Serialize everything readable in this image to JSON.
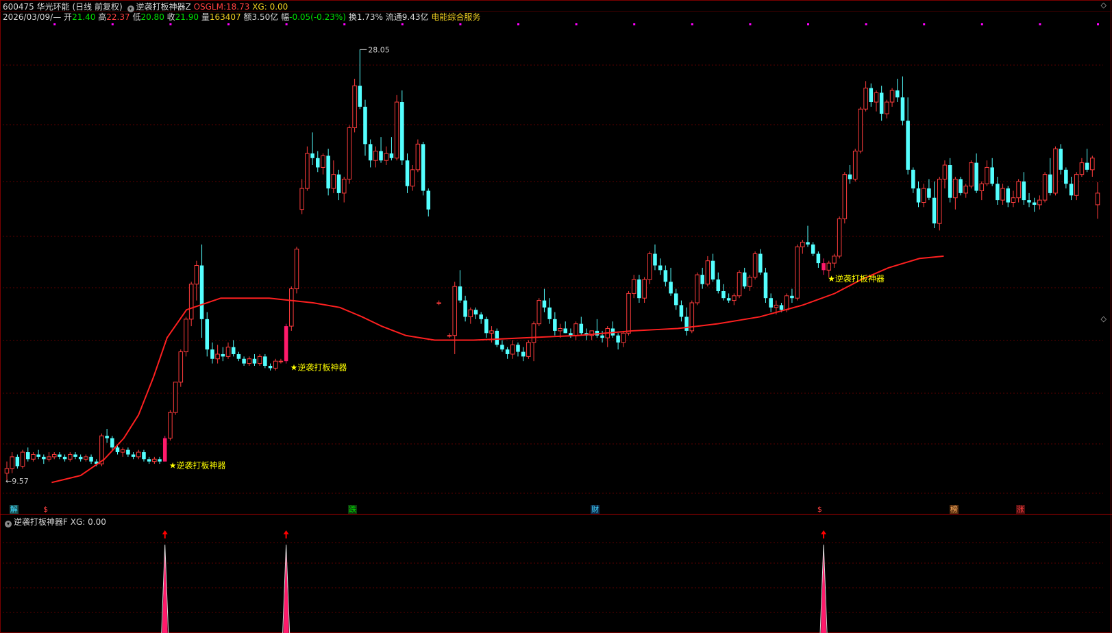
{
  "header": {
    "code": "600475",
    "name": "华光环能",
    "period": "(日线 前复权)",
    "indicator_name": "逆袭打板神器Z",
    "osglm_label": "OSGLM:",
    "osglm_value": "18.73",
    "xg_label": "XG:",
    "xg_value": "0.00",
    "date": "2026/03/09/—",
    "open_label": "开",
    "open": "21.40",
    "high_label": "高",
    "high": "22.37",
    "low_label": "低",
    "low": "20.80",
    "close_label": "收",
    "close": "21.90",
    "volume_label": "量",
    "volume": "163407",
    "amount_label": "额",
    "amount": "3.50亿",
    "change_label": "幅",
    "change": "-0.05(-0.23%)",
    "turnover_label": "换",
    "turnover": "1.73%",
    "float_label": "流通",
    "float_cap": "9.43亿",
    "sector": "电能综合服务"
  },
  "sub_panel": {
    "title": "逆袭打板神器F",
    "xg_label": "XG:",
    "xg_value": "0.00"
  },
  "window_buttons": {
    "top": "◇",
    "bottom": "◇"
  },
  "colors": {
    "background": "#000000",
    "up": "#ff3c3c",
    "down": "#54ffff",
    "ma": "#ff2020",
    "signal": "#ff1a6b",
    "label": "#ffff00",
    "grid": "#7a0000",
    "marker": "#ff00ff"
  },
  "chart_data": {
    "type": "candlestick",
    "price_range": [
      9.57,
      28.05
    ],
    "ylim": [
      8.6,
      29.0
    ],
    "max_label": "28.05",
    "min_label": "9.57",
    "signal_label": "★逆袭打板神器",
    "signals_at": [
      30,
      53,
      155
    ],
    "candles": [
      [
        9.9,
        10.4,
        9.6,
        10.1
      ],
      [
        10.1,
        10.8,
        9.9,
        10.6
      ],
      [
        10.6,
        10.7,
        10.1,
        10.2
      ],
      [
        10.2,
        10.9,
        10.1,
        10.8
      ],
      [
        10.8,
        11.0,
        10.4,
        10.5
      ],
      [
        10.5,
        10.8,
        10.4,
        10.7
      ],
      [
        10.7,
        10.9,
        10.5,
        10.6
      ],
      [
        10.6,
        10.7,
        10.3,
        10.5
      ],
      [
        10.5,
        10.8,
        10.4,
        10.6
      ],
      [
        10.6,
        10.8,
        10.5,
        10.7
      ],
      [
        10.7,
        10.8,
        10.5,
        10.6
      ],
      [
        10.6,
        10.7,
        10.4,
        10.5
      ],
      [
        10.5,
        10.8,
        10.4,
        10.7
      ],
      [
        10.7,
        10.8,
        10.5,
        10.6
      ],
      [
        10.6,
        10.7,
        10.4,
        10.5
      ],
      [
        10.5,
        10.7,
        10.4,
        10.6
      ],
      [
        10.6,
        10.7,
        10.3,
        10.4
      ],
      [
        10.4,
        10.5,
        10.2,
        10.3
      ],
      [
        10.3,
        11.6,
        10.2,
        11.5
      ],
      [
        11.5,
        11.8,
        11.2,
        11.4
      ],
      [
        11.4,
        11.5,
        10.9,
        11.0
      ],
      [
        11.0,
        11.1,
        10.7,
        10.8
      ],
      [
        10.8,
        11.0,
        10.6,
        10.9
      ],
      [
        10.9,
        11.0,
        10.6,
        10.7
      ],
      [
        10.7,
        10.8,
        10.5,
        10.6
      ],
      [
        10.6,
        10.9,
        10.5,
        10.8
      ],
      [
        10.8,
        10.9,
        10.4,
        10.5
      ],
      [
        10.5,
        10.6,
        10.3,
        10.4
      ],
      [
        10.4,
        10.6,
        10.3,
        10.5
      ],
      [
        10.5,
        10.6,
        10.3,
        10.4
      ],
      [
        10.4,
        11.5,
        10.4,
        11.4
      ],
      [
        11.4,
        12.6,
        11.3,
        12.5
      ],
      [
        12.5,
        13.8,
        12.4,
        13.8
      ],
      [
        13.8,
        15.2,
        13.6,
        15.1
      ],
      [
        15.1,
        16.6,
        14.9,
        16.5
      ],
      [
        16.5,
        18.1,
        16.2,
        18.0
      ],
      [
        18.0,
        19.0,
        17.3,
        18.8
      ],
      [
        18.8,
        19.7,
        15.7,
        16.5
      ],
      [
        16.5,
        16.8,
        14.9,
        15.2
      ],
      [
        15.2,
        15.5,
        14.6,
        14.8
      ],
      [
        14.8,
        15.4,
        14.6,
        15.0
      ],
      [
        15.0,
        15.3,
        14.7,
        14.9
      ],
      [
        14.9,
        15.5,
        14.8,
        15.3
      ],
      [
        15.3,
        15.6,
        14.9,
        15.0
      ],
      [
        15.0,
        15.1,
        14.7,
        14.8
      ],
      [
        14.8,
        14.9,
        14.5,
        14.6
      ],
      [
        14.6,
        14.9,
        14.5,
        14.8
      ],
      [
        14.8,
        15.0,
        14.5,
        14.6
      ],
      [
        14.6,
        15.0,
        14.5,
        14.9
      ],
      [
        14.9,
        15.0,
        14.4,
        14.5
      ],
      [
        14.5,
        14.6,
        14.3,
        14.4
      ],
      [
        14.4,
        14.8,
        14.3,
        14.7
      ],
      [
        14.7,
        14.8,
        14.6,
        14.7
      ],
      [
        14.7,
        16.3,
        14.6,
        16.2
      ],
      [
        16.2,
        17.9,
        16.0,
        17.8
      ],
      [
        17.8,
        19.6,
        17.6,
        19.5
      ],
      [
        21.2,
        22.5,
        21.0,
        22.1
      ],
      [
        22.1,
        23.9,
        22.0,
        23.6
      ],
      [
        23.6,
        24.5,
        23.1,
        23.4
      ],
      [
        23.4,
        23.7,
        22.8,
        23.0
      ],
      [
        23.0,
        23.6,
        22.7,
        23.5
      ],
      [
        23.5,
        23.8,
        21.8,
        22.1
      ],
      [
        22.1,
        23.3,
        21.9,
        22.7
      ],
      [
        22.7,
        22.9,
        21.6,
        21.9
      ],
      [
        21.9,
        22.6,
        21.5,
        22.5
      ],
      [
        22.5,
        24.8,
        22.3,
        24.7
      ],
      [
        24.7,
        26.8,
        24.5,
        26.5
      ],
      [
        26.5,
        28.05,
        25.5,
        25.6
      ],
      [
        25.6,
        25.9,
        23.5,
        24.0
      ],
      [
        24.0,
        24.2,
        23.0,
        23.3
      ],
      [
        23.3,
        23.9,
        23.0,
        23.7
      ],
      [
        23.7,
        24.3,
        23.2,
        23.3
      ],
      [
        23.3,
        23.9,
        23.1,
        23.6
      ],
      [
        23.6,
        24.3,
        23.3,
        23.4
      ],
      [
        23.4,
        26.1,
        23.3,
        25.8
      ],
      [
        25.8,
        26.3,
        23.1,
        23.3
      ],
      [
        23.3,
        23.6,
        21.9,
        22.2
      ],
      [
        22.2,
        23.1,
        22.0,
        22.9
      ],
      [
        22.9,
        24.2,
        22.8,
        24.0
      ],
      [
        24.0,
        24.1,
        21.8,
        22.0
      ],
      [
        22.0,
        22.1,
        20.9,
        21.2
      ],
      [
        null,
        null,
        null,
        null
      ],
      [
        17.2,
        17.3,
        17.1,
        17.2
      ],
      [
        null,
        null,
        null,
        null
      ],
      [
        15.8,
        15.9,
        15.7,
        15.8
      ],
      [
        15.8,
        18.1,
        15.0,
        17.9
      ],
      [
        17.9,
        18.6,
        17.2,
        17.3
      ],
      [
        17.3,
        17.5,
        16.4,
        16.6
      ],
      [
        16.6,
        17.0,
        16.3,
        16.9
      ],
      [
        16.9,
        17.0,
        16.5,
        16.7
      ],
      [
        16.7,
        16.8,
        16.3,
        16.5
      ],
      [
        16.5,
        16.6,
        15.7,
        15.9
      ],
      [
        15.9,
        16.2,
        15.5,
        16.0
      ],
      [
        16.0,
        16.1,
        15.3,
        15.4
      ],
      [
        15.4,
        15.6,
        15.1,
        15.2
      ],
      [
        15.2,
        15.3,
        14.8,
        15.0
      ],
      [
        15.0,
        15.6,
        14.8,
        15.4
      ],
      [
        15.4,
        15.5,
        14.9,
        15.1
      ],
      [
        15.1,
        15.3,
        14.7,
        14.9
      ],
      [
        14.9,
        15.6,
        14.8,
        15.5
      ],
      [
        15.5,
        16.4,
        14.7,
        16.3
      ],
      [
        16.3,
        17.4,
        16.2,
        17.3
      ],
      [
        17.3,
        17.8,
        16.8,
        17.0
      ],
      [
        17.0,
        17.4,
        16.3,
        16.5
      ],
      [
        16.5,
        16.8,
        15.8,
        16.0
      ],
      [
        16.0,
        16.3,
        15.7,
        16.1
      ],
      [
        16.1,
        16.4,
        15.9,
        15.9
      ],
      [
        15.9,
        16.1,
        15.7,
        15.8
      ],
      [
        15.8,
        16.4,
        15.6,
        16.3
      ],
      [
        16.3,
        16.6,
        15.8,
        15.9
      ],
      [
        15.9,
        16.1,
        15.6,
        15.8
      ],
      [
        15.8,
        16.0,
        15.6,
        16.0
      ],
      [
        16.0,
        16.5,
        15.7,
        15.8
      ],
      [
        15.8,
        16.0,
        15.5,
        15.7
      ],
      [
        15.7,
        16.2,
        15.3,
        16.1
      ],
      [
        16.1,
        16.4,
        15.7,
        15.8
      ],
      [
        15.8,
        15.9,
        15.2,
        15.5
      ],
      [
        15.5,
        16.0,
        15.3,
        15.9
      ],
      [
        15.9,
        17.7,
        15.8,
        17.6
      ],
      [
        17.6,
        18.4,
        17.4,
        18.2
      ],
      [
        18.2,
        18.4,
        17.2,
        17.4
      ],
      [
        17.4,
        18.3,
        17.2,
        18.2
      ],
      [
        18.2,
        19.4,
        18.0,
        19.3
      ],
      [
        19.3,
        19.7,
        18.6,
        18.8
      ],
      [
        18.8,
        19.1,
        18.4,
        18.6
      ],
      [
        18.6,
        18.8,
        17.9,
        18.1
      ],
      [
        18.1,
        18.7,
        17.5,
        17.6
      ],
      [
        17.6,
        17.8,
        16.9,
        17.1
      ],
      [
        17.1,
        17.3,
        16.4,
        16.6
      ],
      [
        16.6,
        17.0,
        15.8,
        16.0
      ],
      [
        16.0,
        17.3,
        15.9,
        17.2
      ],
      [
        17.2,
        18.5,
        17.1,
        18.4
      ],
      [
        18.4,
        18.7,
        17.8,
        18.0
      ],
      [
        18.0,
        19.2,
        17.9,
        19.0
      ],
      [
        19.0,
        19.3,
        18.1,
        18.2
      ],
      [
        18.2,
        18.5,
        17.6,
        17.7
      ],
      [
        17.7,
        18.0,
        17.3,
        17.4
      ],
      [
        17.4,
        17.6,
        17.2,
        17.3
      ],
      [
        17.3,
        17.6,
        17.1,
        17.5
      ],
      [
        17.5,
        18.6,
        17.4,
        18.5
      ],
      [
        18.5,
        18.7,
        17.8,
        17.9
      ],
      [
        17.9,
        18.4,
        17.7,
        18.3
      ],
      [
        18.3,
        19.4,
        18.2,
        19.3
      ],
      [
        19.3,
        19.5,
        18.4,
        18.5
      ],
      [
        18.5,
        18.7,
        17.2,
        17.4
      ],
      [
        17.4,
        17.6,
        16.8,
        17.0
      ],
      [
        17.0,
        17.3,
        16.7,
        17.1
      ],
      [
        17.1,
        17.2,
        16.8,
        16.9
      ],
      [
        16.9,
        17.6,
        16.8,
        17.5
      ],
      [
        17.5,
        17.8,
        17.2,
        17.4
      ],
      [
        17.4,
        19.7,
        17.3,
        19.6
      ],
      [
        19.6,
        19.9,
        19.3,
        19.8
      ],
      [
        19.8,
        20.5,
        19.6,
        19.7
      ],
      [
        19.7,
        19.8,
        19.2,
        19.3
      ],
      [
        19.3,
        19.4,
        18.7,
        18.9
      ],
      [
        18.9,
        19.1,
        18.4,
        18.6
      ],
      [
        18.6,
        19.0,
        18.3,
        18.9
      ],
      [
        18.9,
        19.3,
        18.7,
        19.2
      ],
      [
        19.2,
        20.9,
        19.1,
        20.8
      ],
      [
        20.8,
        22.8,
        20.6,
        22.7
      ],
      [
        22.7,
        23.1,
        22.3,
        22.5
      ],
      [
        22.5,
        23.8,
        22.4,
        23.7
      ],
      [
        23.7,
        25.6,
        23.6,
        25.5
      ],
      [
        25.5,
        26.7,
        25.4,
        26.4
      ],
      [
        26.4,
        26.6,
        25.6,
        25.8
      ],
      [
        25.8,
        26.3,
        25.4,
        26.2
      ],
      [
        26.2,
        26.5,
        25.0,
        25.3
      ],
      [
        25.3,
        25.9,
        25.1,
        25.8
      ],
      [
        25.8,
        26.4,
        25.6,
        26.3
      ],
      [
        26.3,
        26.8,
        25.8,
        26.0
      ],
      [
        26.0,
        26.9,
        24.8,
        25.0
      ],
      [
        25.0,
        26.0,
        22.7,
        22.9
      ],
      [
        22.9,
        23.0,
        21.9,
        22.1
      ],
      [
        22.1,
        22.4,
        21.3,
        21.5
      ],
      [
        21.5,
        22.3,
        21.3,
        22.1
      ],
      [
        22.1,
        22.5,
        21.6,
        21.7
      ],
      [
        21.7,
        22.4,
        20.4,
        20.6
      ],
      [
        20.6,
        22.6,
        20.3,
        22.5
      ],
      [
        22.5,
        23.3,
        22.1,
        23.1
      ],
      [
        23.1,
        23.4,
        21.5,
        21.7
      ],
      [
        21.7,
        22.6,
        21.2,
        22.5
      ],
      [
        22.5,
        22.6,
        21.8,
        21.9
      ],
      [
        21.9,
        22.3,
        21.7,
        22.2
      ],
      [
        22.2,
        23.3,
        22.1,
        23.2
      ],
      [
        23.2,
        23.6,
        21.9,
        22.0
      ],
      [
        22.0,
        22.4,
        21.6,
        22.3
      ],
      [
        22.3,
        23.3,
        22.2,
        23.0
      ],
      [
        23.0,
        23.4,
        22.2,
        22.3
      ],
      [
        22.3,
        22.6,
        21.4,
        21.6
      ],
      [
        21.6,
        22.3,
        21.4,
        22.1
      ],
      [
        22.1,
        22.2,
        21.3,
        21.5
      ],
      [
        21.5,
        22.0,
        21.3,
        21.7
      ],
      [
        21.7,
        22.5,
        21.5,
        22.4
      ],
      [
        22.4,
        22.8,
        21.4,
        21.6
      ],
      [
        21.6,
        21.9,
        21.3,
        21.5
      ],
      [
        21.5,
        21.7,
        21.1,
        21.4
      ],
      [
        21.4,
        21.8,
        21.2,
        21.6
      ],
      [
        21.6,
        22.8,
        21.5,
        22.7
      ],
      [
        22.7,
        23.4,
        21.8,
        21.9
      ],
      [
        21.9,
        23.9,
        21.8,
        23.8
      ],
      [
        23.8,
        24.0,
        22.7,
        22.9
      ],
      [
        22.9,
        23.0,
        22.1,
        22.3
      ],
      [
        22.3,
        22.6,
        21.6,
        21.8
      ],
      [
        21.8,
        22.8,
        21.6,
        22.7
      ],
      [
        22.7,
        23.4,
        22.6,
        23.2
      ],
      [
        23.2,
        23.8,
        22.8,
        22.9
      ],
      [
        22.9,
        23.5,
        22.6,
        23.4
      ],
      [
        21.4,
        22.37,
        20.8,
        21.9
      ]
    ],
    "ma_line": [
      [
        9.57,
        9.5
      ],
      [
        10.6,
        9.8
      ],
      [
        12.5,
        10.5
      ],
      [
        14.0,
        11.4
      ],
      [
        15.0,
        12.4
      ],
      [
        16.0,
        14.0
      ],
      [
        17.0,
        15.7
      ],
      [
        18.3,
        16.9
      ],
      [
        19.4,
        17.4
      ],
      [
        20.4,
        17.4
      ],
      [
        21.4,
        17.2
      ],
      [
        22.4,
        17.0
      ],
      [
        23.4,
        16.6
      ],
      [
        24.4,
        16.2
      ],
      [
        25.4,
        15.8
      ],
      [
        26.4,
        15.6
      ],
      [
        27.4,
        15.6
      ],
      [
        28.4,
        15.7
      ],
      [
        29.4,
        15.8
      ],
      [
        30.4,
        16.0
      ],
      [
        31.4,
        16.1
      ],
      [
        32.4,
        16.3
      ],
      [
        33.4,
        16.6
      ],
      [
        34.4,
        17.1
      ],
      [
        35.4,
        17.6
      ],
      [
        36.4,
        18.2
      ],
      [
        37.4,
        18.7
      ],
      [
        38.4,
        19.1
      ],
      [
        38.8,
        19.2
      ]
    ],
    "ma_x_days": [
      8.5,
      14.0,
      18.5,
      22.2,
      25.0,
      27.8,
      30.4,
      34.1,
      40.6,
      49.8,
      58.1,
      63.2,
      67.4,
      71.1,
      75.7,
      81.2,
      88.6,
      98.3,
      108.4,
      118.8,
      127.3,
      134.9,
      142.9,
      151.0,
      157.1,
      162.2,
      167.3,
      173.2,
      177.8
    ],
    "sub_chart": {
      "type": "spike",
      "signal_values": [
        1,
        1,
        1
      ],
      "arrow_color": "#ff0000"
    }
  },
  "events": [
    {
      "label": "解",
      "color": "#40d8ff",
      "box": "#1a4d4d"
    },
    {
      "label": "$",
      "color": "#ff4040",
      "box": "#000000"
    },
    {
      "label": "跌",
      "color": "#00e000",
      "box": "#0e3a0e"
    },
    {
      "label": "财",
      "color": "#40d8ff",
      "box": "#0f2e4d"
    },
    {
      "label": "$",
      "color": "#ff4040",
      "box": "#000000"
    },
    {
      "label": "榜",
      "color": "#ffb060",
      "box": "#5a3010"
    },
    {
      "label": "涨",
      "color": "#ff4040",
      "box": "#4d0f0f"
    }
  ],
  "event_days": [
    2,
    12,
    104,
    177,
    245,
    285,
    305
  ]
}
